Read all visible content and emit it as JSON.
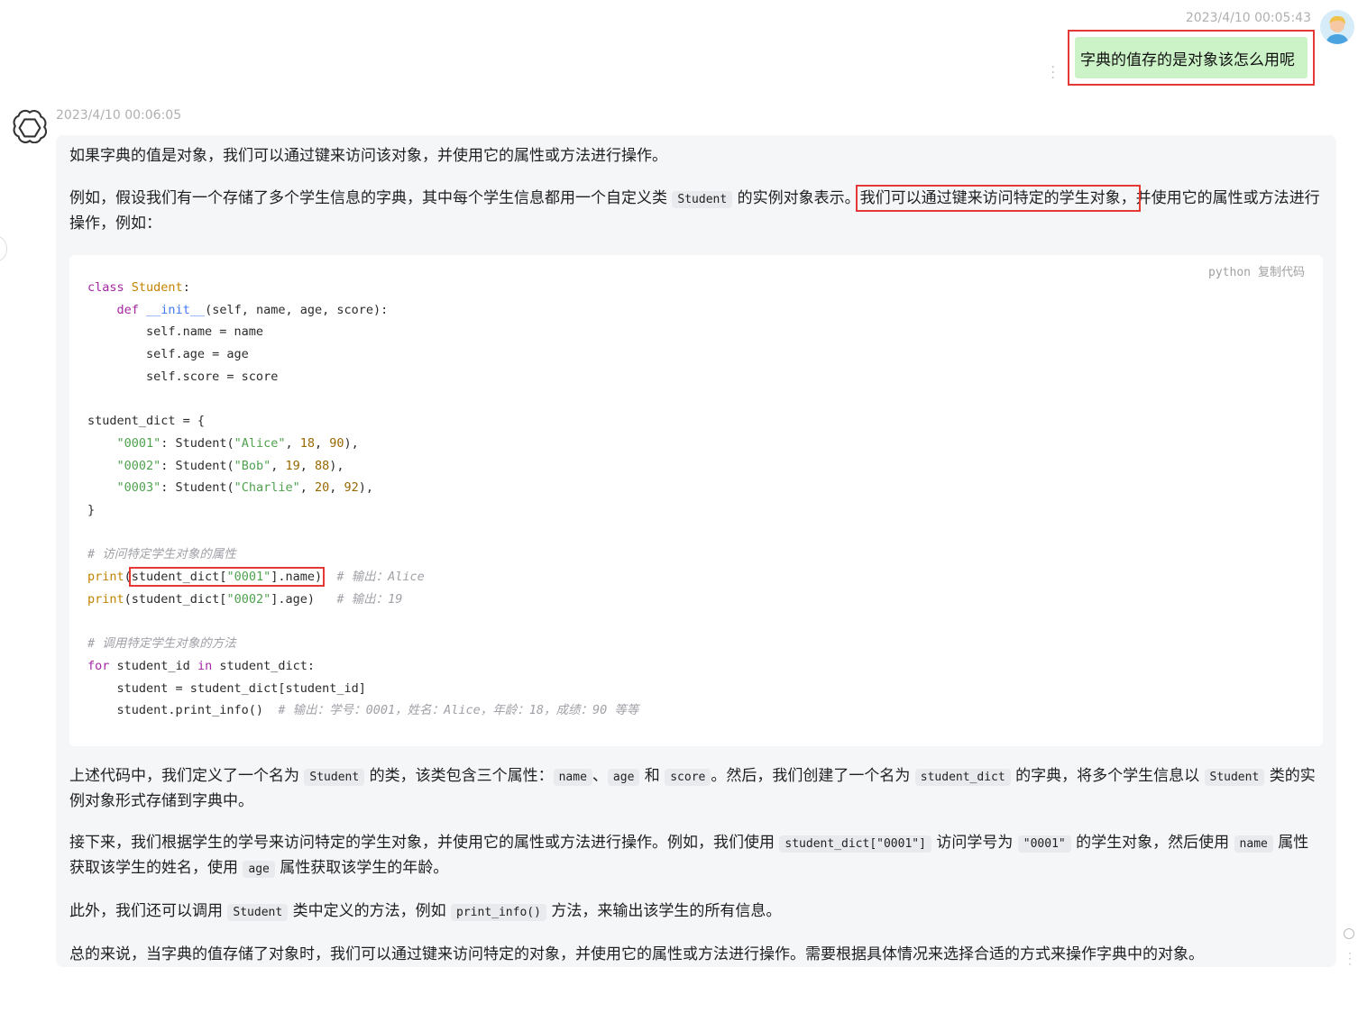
{
  "user_message": {
    "timestamp": "2023/4/10 00:05:43",
    "text": "字典的值存的是对象该怎么用呢"
  },
  "bot_message": {
    "timestamp": "2023/4/10 00:06:05",
    "p1": "如果字典的值是对象，我们可以通过键来访问该对象，并使用它的属性或方法进行操作。",
    "p2_a": "例如，假设我们有一个存储了多个学生信息的字典，其中每个学生信息都用一个自定义类 ",
    "p2_code": "Student",
    "p2_b": " 的实例对象表示。",
    "p2_hl": "我们可以通过键来访问特定的学生对象，",
    "p2_c": "并使用它的属性或方法进行操作，例如：",
    "code": {
      "language": "python",
      "copy_label": "复制代码",
      "comment1": "# 访问特定学生对象的属性",
      "comment2": "# 调用特定学生对象的方法",
      "out_alice": "# 输出：Alice",
      "out_19": "# 输出：19",
      "out_info": "# 输出：学号：0001，姓名：Alice，年龄：18，成绩：90 等等"
    },
    "p3_a": "上述代码中，我们定义了一个名为 ",
    "p3_c1": "Student",
    "p3_b": " 的类，该类包含三个属性：",
    "p3_c2": "name",
    "p3_sep": "、",
    "p3_c3": "age",
    "p3_and": " 和 ",
    "p3_c4": "score",
    "p3_d": "。然后，我们创建了一个名为 ",
    "p3_c5": "student_dict",
    "p3_e": " 的字典，将多个学生信息以 ",
    "p3_c6": "Student",
    "p3_f": " 类的实例对象形式存储到字典中。",
    "p4_a": "接下来，我们根据学生的学号来访问特定的学生对象，并使用它的属性或方法进行操作。例如，我们使用 ",
    "p4_c1": "student_dict[\"0001\"]",
    "p4_b": " 访问学号为 ",
    "p4_c2": "\"0001\"",
    "p4_c": " 的学生对象，然后使用 ",
    "p4_c3": "name",
    "p4_d": " 属性获取该学生的姓名，使用 ",
    "p4_c4": "age",
    "p4_e": " 属性获取该学生的年龄。",
    "p5_a": "此外，我们还可以调用 ",
    "p5_c1": "Student",
    "p5_b": " 类中定义的方法，例如 ",
    "p5_c2": "print_info()",
    "p5_c": " 方法，来输出该学生的所有信息。",
    "p6": "总的来说，当字典的值存储了对象时，我们可以通过键来访问特定的对象，并使用它的属性或方法进行操作。需要根据具体情况来选择合适的方式来操作字典中的对象。"
  }
}
